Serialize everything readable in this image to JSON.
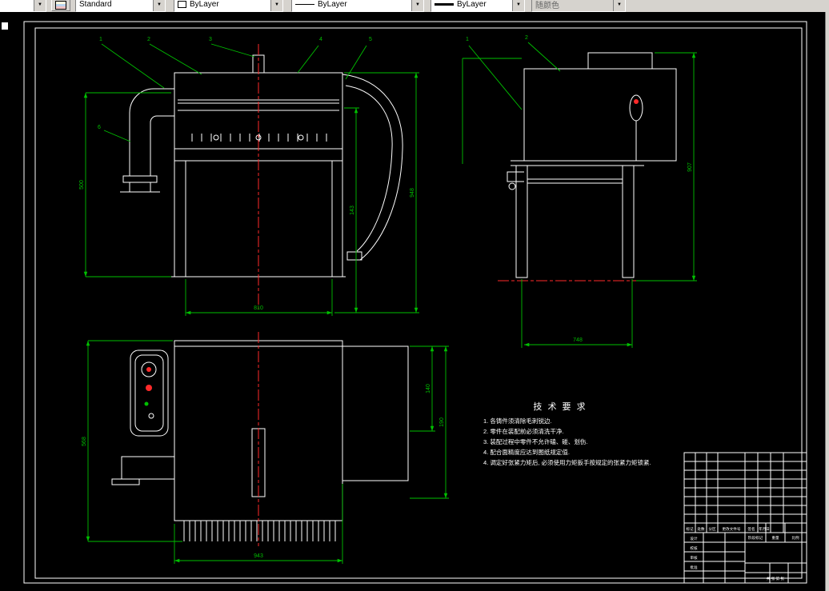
{
  "toolbar": {
    "style": "Standard",
    "color": "ByLayer",
    "linetype": "ByLayer",
    "lineweight": "ByLayer",
    "plot_style": "随颜色"
  },
  "colors": {
    "dimension": "#00c000",
    "object_line": "#ffffff",
    "centerline": "#ff2a2a",
    "canvas_bg": "#000000",
    "toolbar_bg": "#d6d3ce"
  },
  "dims": {
    "front": {
      "left": "500",
      "bottom": "810",
      "right_inner": "143",
      "right_outer": "948"
    },
    "side": {
      "right": "907",
      "bottom": "748"
    },
    "bottom_view": {
      "left": "568",
      "bottom": "943",
      "right_inner": "140",
      "right_outer": "190"
    }
  },
  "callouts": {
    "front": [
      "1",
      "2",
      "3",
      "4",
      "5",
      "6"
    ],
    "side": [
      "1",
      "2"
    ]
  },
  "tech": {
    "title": "技 术 要 求",
    "lines": [
      "1. 各铸件须清除毛刺锐边.",
      "2. 零件在装配前必须清洗干净.",
      "3. 装配过程中零件不允许磕、碰、划伤.",
      "4. 配合面精度应达到图纸规定值.",
      "4. 调定好张紧力矩后, 必须使用力矩扳手按规定的张紧力矩锁紧."
    ]
  },
  "titleblock": {
    "rev": [
      "标记",
      "处数",
      "分区",
      "更改文件号",
      "签名",
      "年月日"
    ],
    "roles": [
      "设计",
      "校核",
      "审核",
      "批准"
    ],
    "fields": [
      "阶段标记",
      "重量",
      "比例"
    ],
    "sheet": "共 张 第 张"
  }
}
